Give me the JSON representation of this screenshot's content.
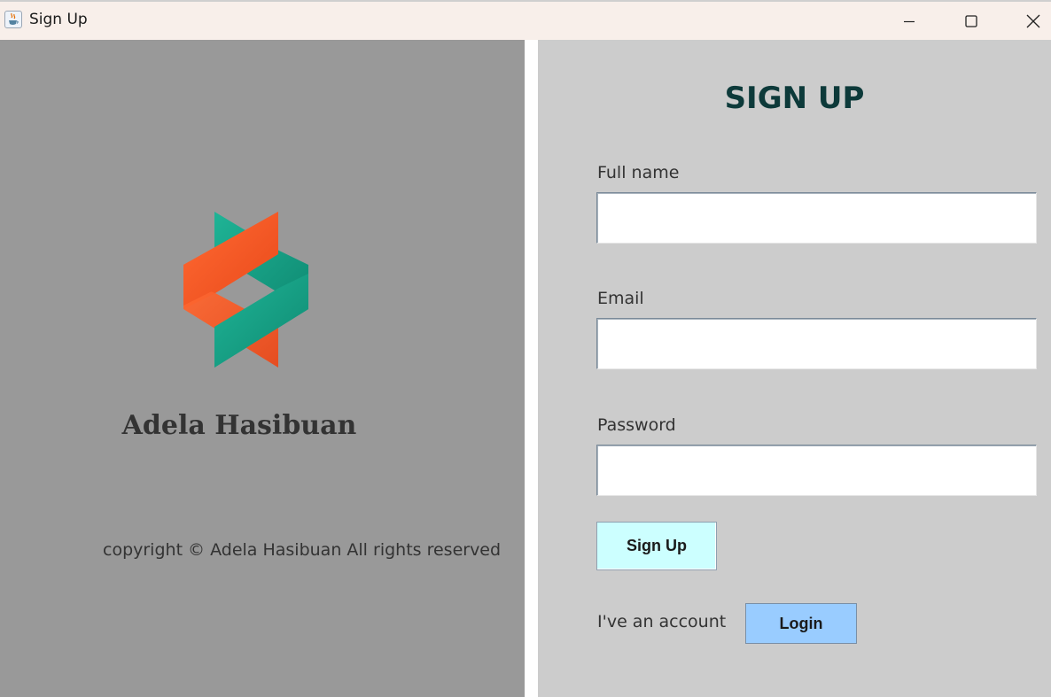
{
  "window": {
    "title": "Sign Up",
    "icon": "java-cup-icon",
    "controls": [
      "minimize-icon",
      "maximize-icon",
      "close-icon"
    ]
  },
  "left_panel": {
    "logo": "brand-logo",
    "brand_name": "Adela Hasibuan",
    "copyright": "copyright © Adela Hasibuan All rights reserved"
  },
  "form": {
    "title": "SIGN UP",
    "fields": {
      "full_name": {
        "label": "Full name",
        "value": ""
      },
      "email": {
        "label": "Email",
        "value": ""
      },
      "password": {
        "label": "Password",
        "value": ""
      }
    },
    "signup_label": "Sign Up",
    "account_text": "I've an account",
    "login_label": "Login"
  },
  "colors": {
    "left_panel_bg": "#999999",
    "right_panel_bg": "#cccccc",
    "signup_button_bg": "#ccffff",
    "login_button_bg": "#99ccff",
    "title_color": "#0d3a3a",
    "logo_orange": "#ff5a26",
    "logo_teal": "#1aa58c"
  }
}
